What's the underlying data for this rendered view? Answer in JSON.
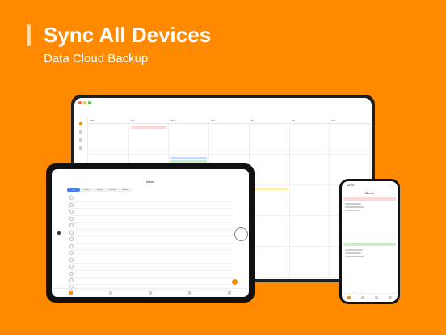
{
  "hero": {
    "title": "Sync All Devices",
    "subtitle": "Data Cloud Backup"
  },
  "colors": {
    "background": "#FF8A00",
    "accent_bar": "#FFD9A8",
    "event_blue": "#c9d8ff",
    "event_green": "#cdeccf",
    "event_yellow": "#ffe9a8"
  },
  "laptop": {
    "day_headers": [
      "Mon",
      "Tue",
      "Wed",
      "Thu",
      "Fri",
      "Sat",
      "Sun"
    ]
  },
  "tablet": {
    "title": "Week",
    "segments": [
      "All",
      "Today",
      "Week",
      "Month",
      "Search"
    ]
  },
  "phone": {
    "status_time": "13:20",
    "title": "Month"
  }
}
